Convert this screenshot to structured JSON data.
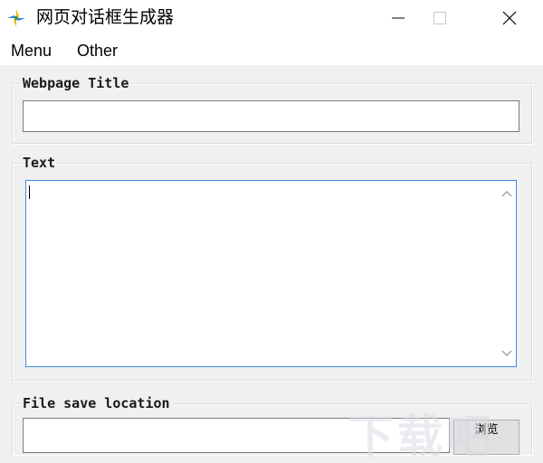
{
  "window": {
    "title": "网页对话框生成器",
    "icons": {
      "app": "app-logo-icon",
      "minimize": "minimize-icon",
      "maximize": "maximize-icon",
      "close": "close-icon"
    }
  },
  "menu": {
    "items": [
      "Menu",
      "Other"
    ]
  },
  "groups": {
    "webpage_title": {
      "label": "Webpage Title",
      "value": ""
    },
    "text": {
      "label": "Text",
      "value": ""
    },
    "file_save": {
      "label": "File save location",
      "value": "",
      "browse_label": "浏览"
    }
  },
  "watermark": {
    "text": "下载吧"
  },
  "colors": {
    "focus_border": "#3c8ddc",
    "window_bg": "#f0f0f0"
  }
}
